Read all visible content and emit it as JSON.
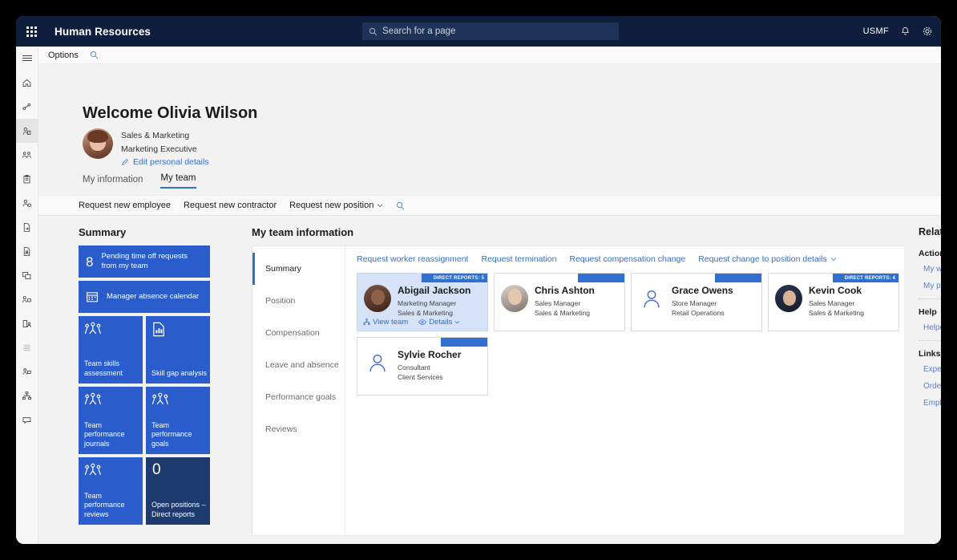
{
  "topbar": {
    "waffle_icon": "waffle-grid-icon",
    "app_title": "Human Resources",
    "search_placeholder": "Search for a page",
    "search_icon": "search-icon",
    "company": "USMF",
    "notification_icon": "bell-icon",
    "settings_icon": "gear-icon"
  },
  "optionsbar": {
    "options_label": "Options",
    "search_icon": "search-icon"
  },
  "rail": {
    "hamburger_icon": "hamburger-icon",
    "items": [
      {
        "icon": "home-icon",
        "active": false
      },
      {
        "icon": "org-hierarchy-icon",
        "active": false
      },
      {
        "icon": "person-badge-icon",
        "active": true
      },
      {
        "icon": "people-group-icon",
        "active": false
      },
      {
        "icon": "clipboard-icon",
        "active": false
      },
      {
        "icon": "person-settings-icon",
        "active": false
      },
      {
        "icon": "document-arrow-icon",
        "active": false
      },
      {
        "icon": "document-person-icon",
        "active": false
      },
      {
        "icon": "windows-stack-icon",
        "active": false
      },
      {
        "icon": "person-network-icon",
        "active": false
      },
      {
        "icon": "report-person-icon",
        "active": false
      },
      {
        "icon": "list-lines-icon",
        "active": false
      },
      {
        "icon": "briefcase-person-icon",
        "active": false
      },
      {
        "icon": "sitemap-icon",
        "active": false
      },
      {
        "icon": "feedback-icon",
        "active": false
      }
    ]
  },
  "header": {
    "welcome": "Welcome Olivia Wilson",
    "avatar": "user-photo-olivia",
    "department": "Sales & Marketing",
    "job_title": "Marketing Executive",
    "edit_link": "Edit personal details",
    "edit_icon": "pencil-icon"
  },
  "tabs": [
    {
      "label": "My information",
      "active": false
    },
    {
      "label": "My team",
      "active": true
    }
  ],
  "actionbar": {
    "items": [
      {
        "label": "Request new employee",
        "caret": false
      },
      {
        "label": "Request new contractor",
        "caret": false
      },
      {
        "label": "Request new position",
        "caret": true
      }
    ],
    "search_icon": "search-icon"
  },
  "summary": {
    "title": "Summary",
    "tiles": [
      {
        "kind": "wide",
        "number": "8",
        "label": "Pending time off requests from my team",
        "icon": null,
        "dark": false
      },
      {
        "kind": "wide",
        "number": null,
        "label": "Manager absence calendar",
        "icon": "calendar-icon",
        "dark": false
      },
      {
        "kind": "small",
        "label": "Team skills assessment",
        "icon": "people-group-icon",
        "dark": false
      },
      {
        "kind": "small",
        "label": "Skill gap analysis",
        "icon": "report-document-icon",
        "dark": false
      },
      {
        "kind": "small",
        "label": "Team performance journals",
        "icon": "people-group-icon",
        "dark": false
      },
      {
        "kind": "small",
        "label": "Team performance goals",
        "icon": "people-group-icon",
        "dark": false
      },
      {
        "kind": "small",
        "label": "Team performance reviews",
        "icon": "people-group-icon",
        "dark": false
      },
      {
        "kind": "small",
        "number": "0",
        "label": "Open positions – Direct reports",
        "icon": null,
        "dark": true
      }
    ]
  },
  "main": {
    "title": "My team information",
    "nav": [
      {
        "label": "Summary",
        "active": true
      },
      {
        "label": "Position",
        "active": false
      },
      {
        "label": "Compensation",
        "active": false
      },
      {
        "label": "Leave and absence",
        "active": false
      },
      {
        "label": "Performance goals",
        "active": false
      },
      {
        "label": "Reviews",
        "active": false
      }
    ],
    "links": [
      {
        "label": "Request worker reassignment",
        "caret": false
      },
      {
        "label": "Request termination",
        "caret": false
      },
      {
        "label": "Request compensation change",
        "caret": false
      },
      {
        "label": "Request change to position details",
        "caret": true
      }
    ],
    "cards": [
      {
        "name": "Abigail Jackson",
        "title": "Marketing Manager",
        "department": "Sales & Marketing",
        "badge": "DIRECT REPORTS: 5",
        "badge_width": 82,
        "avatar": "user-photo-abigail",
        "selected": true,
        "actions": [
          {
            "label": "View team",
            "icon": "team-icon"
          },
          {
            "label": "Details",
            "icon": "details-icon",
            "caret": true
          }
        ]
      },
      {
        "name": "Chris Ashton",
        "title": "Sales Manager",
        "department": "Sales & Marketing",
        "badge": "",
        "badge_width": 58,
        "avatar": "user-photo-chris",
        "selected": false,
        "actions": []
      },
      {
        "name": "Grace Owens",
        "title": "Store Manager",
        "department": "Retail Operations",
        "badge": "",
        "badge_width": 58,
        "avatar": "user-placeholder-icon",
        "selected": false,
        "actions": []
      },
      {
        "name": "Kevin Cook",
        "title": "Sales Manager",
        "department": "Sales & Marketing",
        "badge": "DIRECT REPORTS: 4",
        "badge_width": 82,
        "avatar": "user-photo-kevin",
        "selected": false,
        "actions": []
      },
      {
        "name": "Sylvie Rocher",
        "title": "Consultant",
        "department": "Client Services",
        "badge": "",
        "badge_width": 58,
        "avatar": "user-placeholder-icon",
        "selected": false,
        "actions": []
      }
    ]
  },
  "related": {
    "title": "Related",
    "sections": [
      {
        "heading": "Actions",
        "links": [
          "My worke",
          "My positi"
        ]
      },
      {
        "heading": "Help",
        "links": [
          "Helpdesk"
        ]
      },
      {
        "heading": "Links",
        "links": [
          "Expenses",
          "Order a d",
          "Employee"
        ]
      }
    ]
  },
  "colors": {
    "navy": "#0f1e3d",
    "tile_blue": "#2b5ccc",
    "tile_dark": "#1e3a6e",
    "accent_link": "#2f6fd0",
    "page_bg": "#f2f2f2"
  }
}
